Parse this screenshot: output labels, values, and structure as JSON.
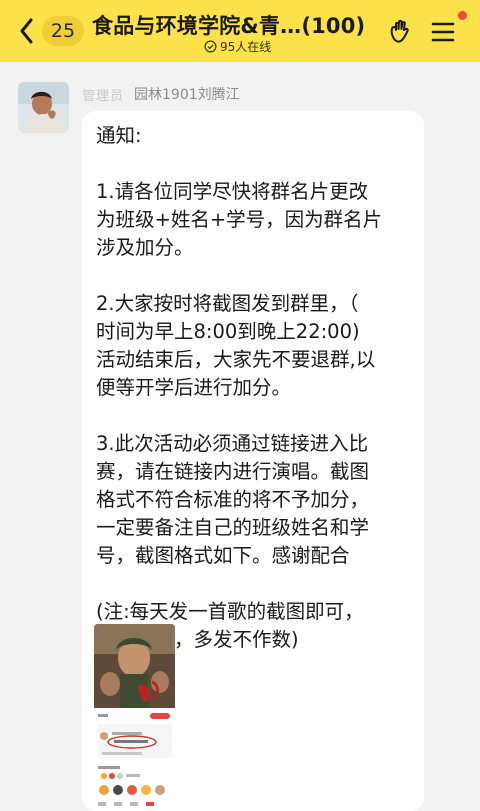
{
  "header": {
    "unread_count": "25",
    "group_title": "食品与环境学院&青…(100)",
    "online_text": "95人在线",
    "icons": [
      "back-chevron-icon",
      "online-status-icon",
      "group-call-icon",
      "menu-icon"
    ],
    "colors": {
      "header_bg": "#fbe24a",
      "badge_bg": "#efcf35",
      "notif_dot": "#f0483e"
    }
  },
  "message": {
    "role_badge": "管理员",
    "sender_name": "园林1901刘腾江",
    "lines": [
      "通知:",
      "",
      "1.请各位同学尽快将群名片更改",
      "为班级+姓名+学号，因为群名片",
      "涉及加分。",
      "",
      "2.大家按时将截图发到群里，（",
      "时间为早上8:00到晚上22:00)",
      "活动结束后，大家先不要退群,以",
      "便等开学后进行加分。",
      "",
      "3.此次活动必须通过链接进入比",
      "赛，请在链接内进行演唱。截图",
      "格式不符合标准的将不予加分，",
      "一定要备注自己的班级姓名和学",
      "号，截图格式如下。感谢配合",
      "",
      "(注:每天发一首歌的截图即可，",
      "顺序不限，多发不作数)"
    ]
  }
}
